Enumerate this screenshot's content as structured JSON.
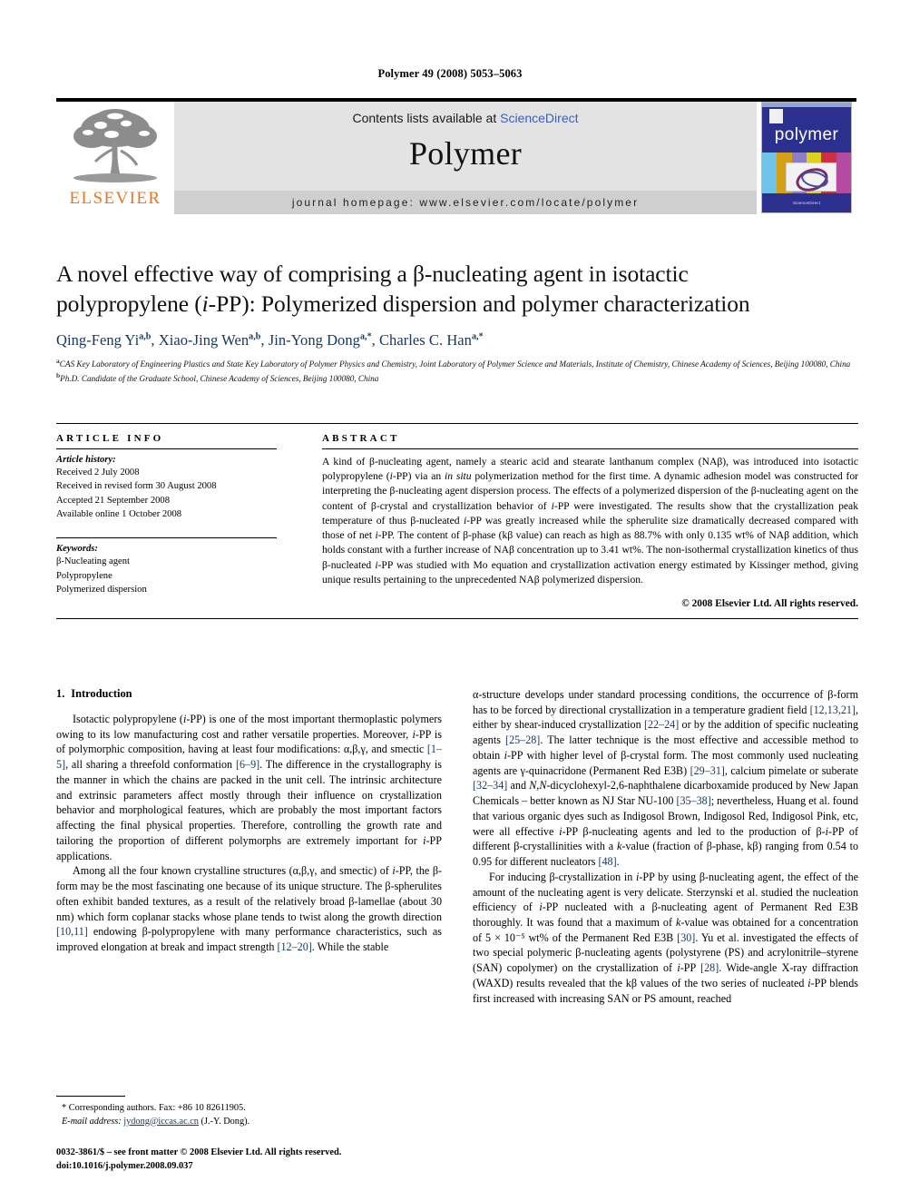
{
  "running_head": "Polymer 49 (2008) 5053–5063",
  "masthead": {
    "contents_prefix": "Contents lists available at ",
    "sciencedirect": "ScienceDirect",
    "journal_title": "Polymer",
    "homepage": "journal homepage: www.elsevier.com/locate/polymer",
    "publisher_logo_text": "ELSEVIER",
    "cover_title": "polymer",
    "cover_footer": "ScienceDirect"
  },
  "article": {
    "title_line1": "A novel effective way of comprising a β-nucleating agent in isotactic",
    "title_line2_pre": "polypropylene (",
    "title_line2_it": "i",
    "title_line2_post": "-PP): Polymerized dispersion and polymer characterization",
    "authors": [
      {
        "name": "Qing-Feng Yi",
        "sup": "a,b",
        "sep": ", "
      },
      {
        "name": "Xiao-Jing Wen",
        "sup": "a,b",
        "sep": ", "
      },
      {
        "name": "Jin-Yong Dong",
        "sup": "a,*",
        "sep": ", "
      },
      {
        "name": "Charles C. Han",
        "sup": "a,*",
        "sep": ""
      }
    ],
    "affiliations": [
      {
        "sup": "a",
        "text": "CAS Key Laboratory of Engineering Plastics and State Key Laboratory of Polymer Physics and Chemistry, Joint Laboratory of Polymer Science and Materials, Institute of Chemistry, Chinese Academy of Sciences, Beijing 100080, China"
      },
      {
        "sup": "b",
        "text": "Ph.D. Candidate of the Graduate School, Chinese Academy of Sciences, Beijing 100080, China"
      }
    ]
  },
  "article_info": {
    "heading": "ARTICLE INFO",
    "history_label": "Article history:",
    "history": [
      "Received 2 July 2008",
      "Received in revised form 30 August 2008",
      "Accepted 21 September 2008",
      "Available online 1 October 2008"
    ],
    "keywords_label": "Keywords:",
    "keywords": [
      "β-Nucleating agent",
      "Polypropylene",
      "Polymerized dispersion"
    ]
  },
  "abstract": {
    "heading": "ABSTRACT",
    "text": "A kind of β-nucleating agent, namely a stearic acid and stearate lanthanum complex (NAβ), was introduced into isotactic polypropylene (i-PP) via an in situ polymerization method for the first time. A dynamic adhesion model was constructed for interpreting the β-nucleating agent dispersion process. The effects of a polymerized dispersion of the β-nucleating agent on the content of β-crystal and crystallization behavior of i-PP were investigated. The results show that the crystallization peak temperature of thus β-nucleated i-PP was greatly increased while the spherulite size dramatically decreased compared with those of net i-PP. The content of β-phase (kβ value) can reach as high as 88.7% with only 0.135 wt% of NAβ addition, which holds constant with a further increase of NAβ concentration up to 3.41 wt%. The non-isothermal crystallization kinetics of thus β-nucleated i-PP was studied with Mo equation and crystallization activation energy estimated by Kissinger method, giving unique results pertaining to the unprecedented NAβ polymerized dispersion.",
    "copyright": "© 2008 Elsevier Ltd. All rights reserved."
  },
  "introduction": {
    "number": "1.",
    "heading": "Introduction",
    "left_paragraphs": [
      "Isotactic polypropylene (i-PP) is one of the most important thermoplastic polymers owing to its low manufacturing cost and rather versatile properties. Moreover, i-PP is of polymorphic composition, having at least four modifications: α,β,γ, and smectic [1–5], all sharing a threefold conformation [6–9]. The difference in the crystallography is the manner in which the chains are packed in the unit cell. The intrinsic architecture and extrinsic parameters affect mostly through their influence on crystallization behavior and morphological features, which are probably the most important factors affecting the final physical properties. Therefore, controlling the growth rate and tailoring the proportion of different polymorphs are extremely important for i-PP applications.",
      "Among all the four known crystalline structures (α,β,γ, and smectic) of i-PP, the β-form may be the most fascinating one because of its unique structure. The β-spherulites often exhibit banded textures, as a result of the relatively broad β-lamellae (about 30 nm) which form coplanar stacks whose plane tends to twist along the growth direction [10,11] endowing β-polypropylene with many performance characteristics, such as improved elongation at break and impact strength [12–20]. While the stable"
    ],
    "right_paragraphs": [
      "α-structure develops under standard processing conditions, the occurrence of β-form has to be forced by directional crystallization in a temperature gradient field [12,13,21], either by shear-induced crystallization [22–24] or by the addition of specific nucleating agents [25–28]. The latter technique is the most effective and accessible method to obtain i-PP with higher level of β-crystal form. The most commonly used nucleating agents are γ-quinacridone (Permanent Red E3B) [29–31], calcium pimelate or suberate [32–34] and N,N-dicyclohexyl-2,6-naphthalene dicarboxamide produced by New Japan Chemicals – better known as NJ Star NU-100 [35–38]; nevertheless, Huang et al. found that various organic dyes such as Indigosol Brown, Indigosol Red, Indigosol Pink, etc, were all effective i-PP β-nucleating agents and led to the production of β-i-PP of different β-crystallinities with a k-value (fraction of β-phase, kβ) ranging from 0.54 to 0.95 for different nucleators [48].",
      "For inducing β-crystallization in i-PP by using β-nucleating agent, the effect of the amount of the nucleating agent is very delicate. Sterzynski et al. studied the nucleation efficiency of i-PP nucleated with a β-nucleating agent of Permanent Red E3B thoroughly. It was found that a maximum of k-value was obtained for a concentration of 5 × 10⁻⁵ wt% of the Permanent Red E3B [30]. Yu et al. investigated the effects of two special polymeric β-nucleating agents (polystyrene (PS) and acrylonitrile–styrene (SAN) copolymer) on the crystallization of i-PP [28]. Wide-angle X-ray diffraction (WAXD) results revealed that the kβ values of the two series of nucleated i-PP blends first increased with increasing SAN or PS amount, reached"
    ]
  },
  "footnotes": {
    "corresponding": "* Corresponding authors. Fax: +86 10 82611905.",
    "email_label": "E-mail address:",
    "email": "jydong@iccas.ac.cn",
    "email_attrib": "(J.-Y. Dong)."
  },
  "imprint": {
    "line1": "0032-3861/$ – see front matter © 2008 Elsevier Ltd. All rights reserved.",
    "line2": "doi:10.1016/j.polymer.2008.09.037"
  },
  "colors": {
    "link_blue": "#3b5fbb",
    "ref_navy": "#17365d",
    "elsevier_orange": "#E87722",
    "masthead_gray": "#e3e3e3",
    "homepage_gray": "#cfcfcf",
    "cover_blue": "#2b2f8e"
  }
}
